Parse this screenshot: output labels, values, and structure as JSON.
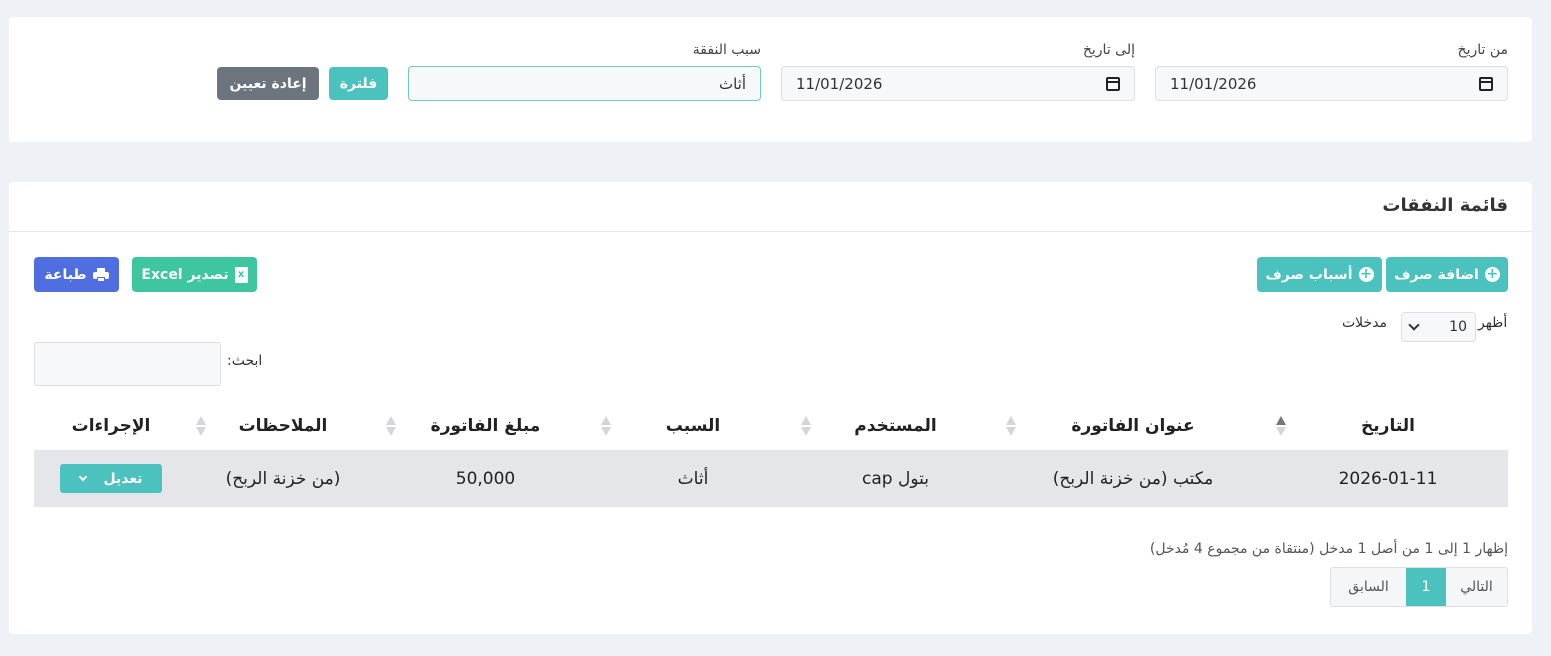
{
  "filters": {
    "from_label": "من تاريخ",
    "from_value": "11/01/2026",
    "to_label": "إلى تاريخ",
    "to_value": "11/01/2026",
    "reason_label": "سبب النفقة",
    "reason_value": "أثاث",
    "filter_button": "فلترة",
    "reset_button": "إعادة تعيين"
  },
  "list": {
    "title": "قائمة النفقات",
    "add_expense_button": "اضافة صرف",
    "expense_reasons_button": "أسباب صرف",
    "export_button": "تصدير Excel",
    "print_button": "طباعة",
    "show_label": "أظهر",
    "page_size": "10",
    "entries_label": "مدخلات",
    "search_label": "ابحث:",
    "columns": [
      "التاريخ",
      "عنوان الفاتورة",
      "المستخدم",
      "السبب",
      "مبلغ الفاتورة",
      "الملاحظات",
      "الإجراءات"
    ],
    "rows": [
      {
        "date": "2026-01-11",
        "invoice_title": "مكتب (من خزنة الربح)",
        "user": "بتول cap",
        "reason": "أثاث",
        "amount": "50,000",
        "notes": "(من خزنة الربح)",
        "action": "تعديل"
      }
    ],
    "summary": "إظهار 1 إلى 1 من أصل 1 مدخل (منتقاة من مجموع 4 مُدخل)",
    "pagination": {
      "next": "التالي",
      "current": "1",
      "previous": "السابق"
    }
  }
}
